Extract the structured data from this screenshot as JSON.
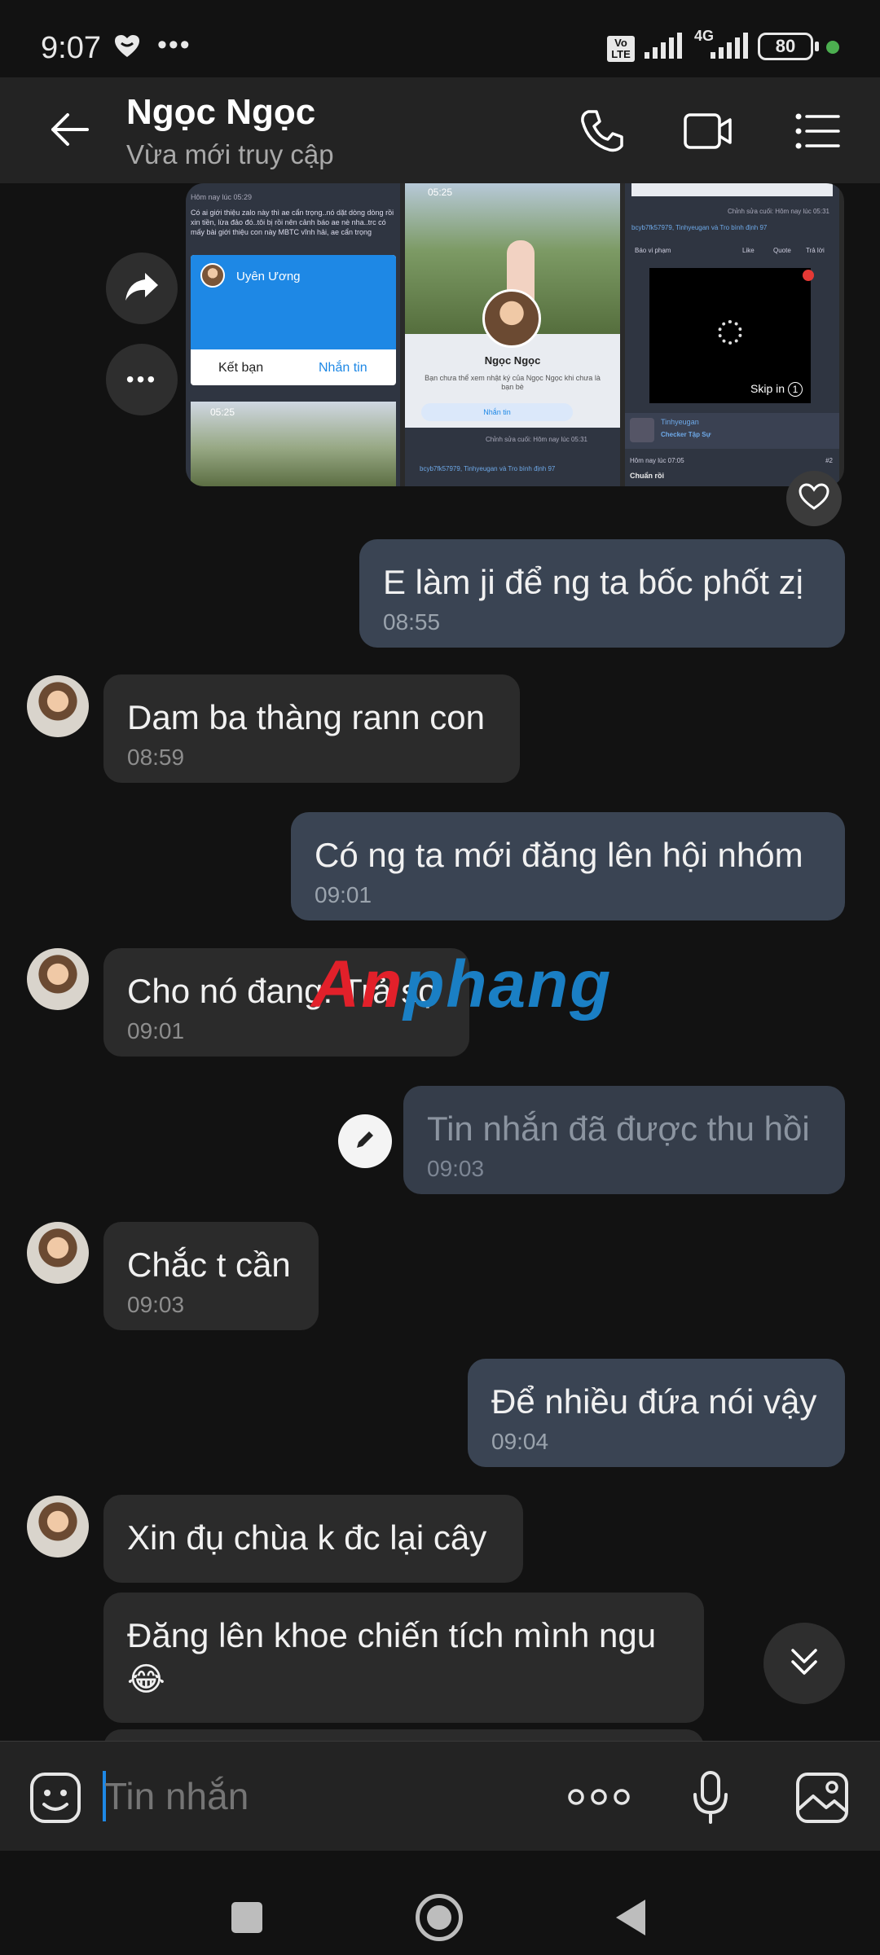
{
  "status_bar": {
    "time": "9:07",
    "network_badge": "Vo LTE",
    "network_type": "4G",
    "battery": "80",
    "icons": [
      "heart-app-icon",
      "more-dots-icon",
      "volte-icon",
      "signal-icon",
      "4g-signal-icon",
      "battery-icon",
      "green-dot-icon"
    ]
  },
  "header": {
    "contact_name": "Ngọc Ngọc",
    "presence": "Vừa mới truy cập",
    "icons": [
      "back-arrow-icon",
      "phone-icon",
      "video-camera-icon",
      "menu-list-icon"
    ]
  },
  "shared_screens": {
    "screen1": {
      "top_text": "Hôm nay lúc 05:29",
      "post_text": "Có ai giới thiệu zalo này thì ae cẩn trọng..nó dặt dòng dòng rồi xin tiền, lừa đảo đó..tôi bị rồi nên cảnh báo ae nè nha..trc có mấy bài giới thiệu con này MBTC vĩnh hải, ae cẩn trọng",
      "card_name": "Uyên Ương",
      "btn_friend": "Kết bạn",
      "btn_message": "Nhắn tin",
      "bottom_time": "05:25"
    },
    "screen2": {
      "time": "05:25",
      "profile_name": "Ngọc Ngọc",
      "profile_note": "Bạn chưa thể xem nhật ký của Ngọc Ngọc khi chưa là bạn bè",
      "btn_message": "Nhắn tin",
      "edit_time": "Chỉnh sửa cuối: Hôm nay lúc 05:31",
      "likers": "bcyb7fk57979, Tinhyeugan và Tro bình định 97"
    },
    "screen3": {
      "edit_time": "Chỉnh sửa cuối: Hôm nay lúc 05:31",
      "likers": "bcyb7fk57979, Tinhyeugan và Tro bình định 97",
      "report": "Báo vi phạm",
      "like": "Like",
      "quote": "Quote",
      "reply": "Trả lời",
      "skip": "Skip in",
      "skip_count": "1",
      "user": "Tinhyeugan",
      "user_role": "Checker Tập Sự",
      "post_time": "Hôm nay lúc 07:05",
      "post_num": "#2",
      "post_text": "Chuẩn rồi"
    }
  },
  "messages": [
    {
      "dir": "out",
      "text": "E làm ji để ng ta bốc phốt zị",
      "time": "08:55"
    },
    {
      "dir": "in",
      "text": "Dam ba thàng rann con",
      "time": "08:59"
    },
    {
      "dir": "out",
      "text": "Có ng ta mới đăng lên hội nhóm",
      "time": "09:01"
    },
    {
      "dir": "in",
      "text": "Cho nó đang. Trả sợ",
      "time": "09:01"
    },
    {
      "dir": "out",
      "text": "Tin nhắn đã được thu hồi",
      "time": "09:03"
    },
    {
      "dir": "in",
      "text": "Chắc t cần",
      "time": "09:03"
    },
    {
      "dir": "out",
      "text": "Để nhiều đứa nói vậy",
      "time": "09:04"
    },
    {
      "dir": "in",
      "text": "Xin đụ chùa k đc lại cây"
    },
    {
      "dir": "in",
      "text": "Đăng lên khoe chiến tích mình ngu",
      "emoji": "😂"
    }
  ],
  "watermark": {
    "part1": "An",
    "part2": "phang"
  },
  "input": {
    "placeholder": "Tin nhắn",
    "icons": [
      "emoji-sticker-icon",
      "more-options-icon",
      "microphone-icon",
      "image-gallery-icon"
    ]
  },
  "side_icons": [
    "share-arrow-icon",
    "more-dots-icon",
    "heart-reaction-icon",
    "pencil-icon",
    "scroll-down-icon"
  ],
  "nav_icons": [
    "recent-apps-icon",
    "home-icon",
    "back-icon"
  ],
  "colors": {
    "outgoing_bubble": "#3a4453",
    "incoming_bubble": "#2b2b2b",
    "header_bg": "#232323",
    "accent_blue": "#1e88e5"
  }
}
